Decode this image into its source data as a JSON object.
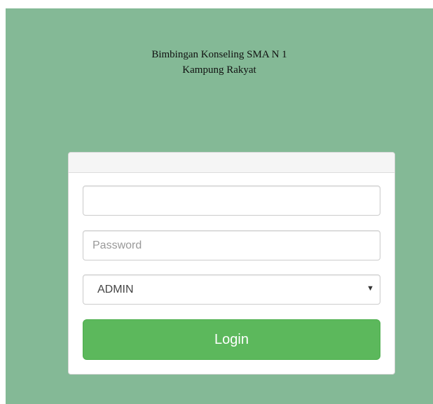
{
  "header": {
    "title_line1": "Bimbingan Konseling SMA N 1",
    "title_line2": "Kampung Rakyat"
  },
  "login_form": {
    "username": {
      "value": "",
      "placeholder": ""
    },
    "password": {
      "value": "",
      "placeholder": "Password"
    },
    "role": {
      "selected": "ADMIN"
    },
    "submit_label": "Login"
  },
  "colors": {
    "background": "#84b996",
    "button": "#5cb85c"
  },
  "icons": {
    "select_caret": "caret-down-icon"
  }
}
